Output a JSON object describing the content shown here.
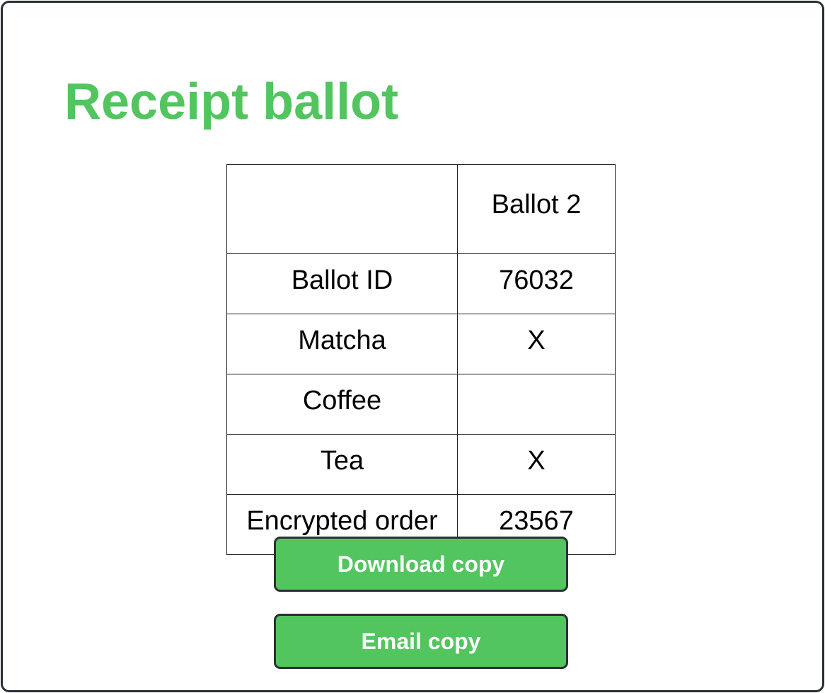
{
  "page": {
    "title": "Receipt ballot"
  },
  "table": {
    "header": {
      "label": "",
      "value": "Ballot 2"
    },
    "rows": [
      {
        "label": "Ballot ID",
        "value": "76032"
      },
      {
        "label": "Matcha",
        "value": "X"
      },
      {
        "label": "Coffee",
        "value": ""
      },
      {
        "label": "Tea",
        "value": "X"
      },
      {
        "label": "Encrypted order",
        "value": "23567"
      }
    ]
  },
  "actions": {
    "download_label": "Download copy",
    "email_label": "Email copy"
  },
  "colors": {
    "accent": "#52c55f",
    "border": "#2b2f33",
    "text": "#000000",
    "button_text": "#ffffff"
  }
}
